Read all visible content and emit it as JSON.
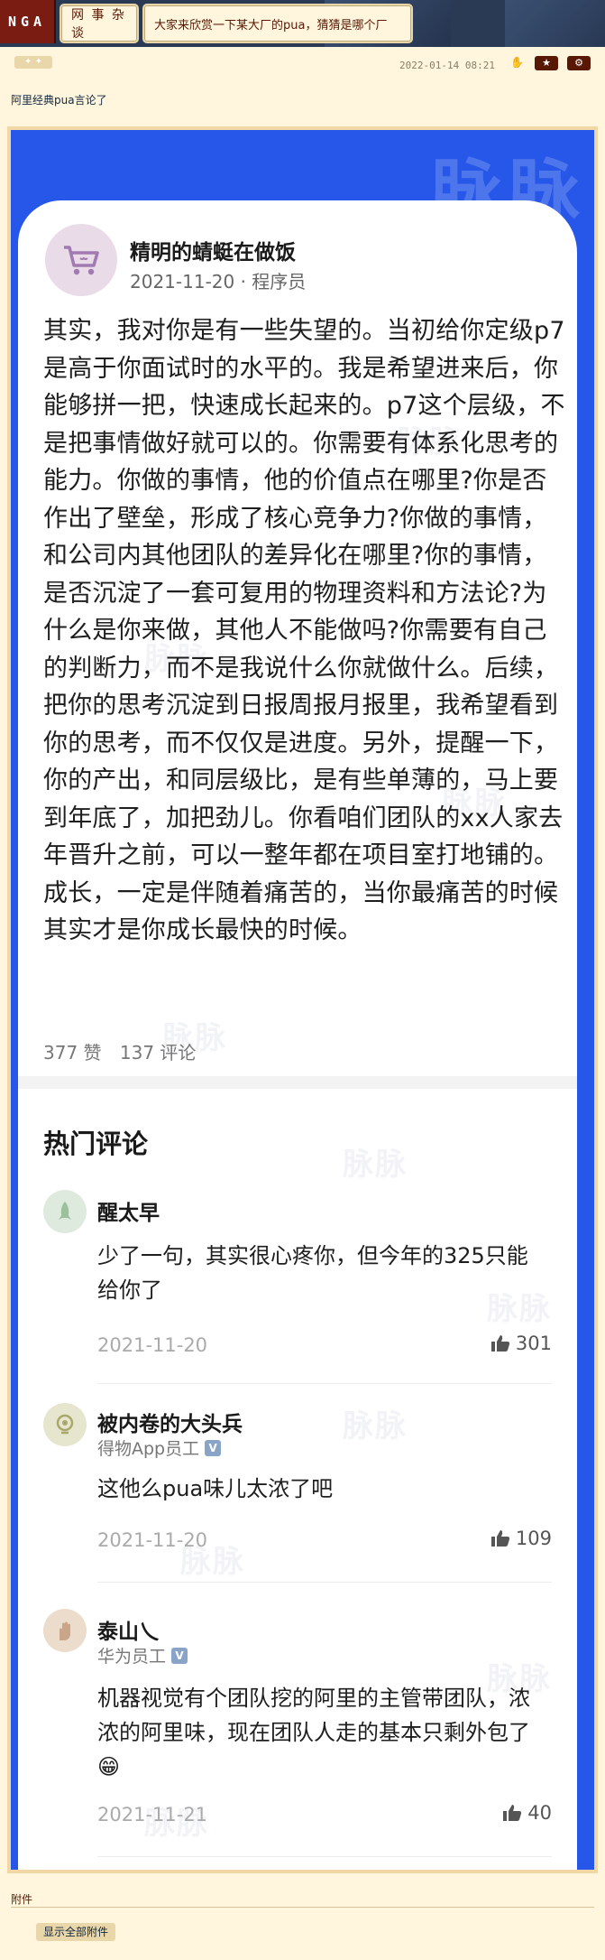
{
  "nav": {
    "logo": "NGA",
    "forum": "网 事 杂 谈",
    "thread_title": "大家来欣赏一下某大厂的pua，猜猜是哪个厂"
  },
  "post": {
    "time": "2022-01-14 08:21",
    "subject": "阿里经典pua言论了",
    "buttons": {
      "star": "★",
      "gear": "⚙"
    }
  },
  "image": {
    "watermark": "脉脉",
    "author": "精明的蜻蜓在做饭",
    "meta": "2021-11-20 · 程序员",
    "body": "其实，我对你是有一些失望的。当初给你定级p7是高于你面试时的水平的。我是希望进来后，你能够拼一把，快速成长起来的。p7这个层级，不是把事情做好就可以的。你需要有体系化思考的能力。你做的事情，他的价值点在哪里?你是否作出了壁垒，形成了核心竞争力?你做的事情，和公司内其他团队的差异化在哪里?你的事情，是否沉淀了一套可复用的物理资料和方法论?为什么是你来做，其他人不能做吗?你需要有自己的判断力，而不是我说什么你就做什么。后续，把你的思考沉淀到日报周报月报里，我希望看到你的思考，而不仅仅是进度。另外，提醒一下，你的产出，和同层级比，是有些单薄的，马上要到年底了，加把劲儿。你看咱们团队的xx人家去年晋升之前，可以一整年都在项目室打地铺的。成长，一定是伴随着痛苦的，当你最痛苦的时候其实才是你成长最快的时候。",
    "likes": "377 赞",
    "comments": "137 评论",
    "hot_title": "热门评论",
    "hot_comments": [
      {
        "name": "醒太早",
        "org": "",
        "text": "少了一句，其实很心疼你，但今年的325只能给你了",
        "date": "2021-11-20",
        "likes": "301"
      },
      {
        "name": "被内卷的大头兵",
        "org": "得物App员工",
        "text": "这他么pua味儿太浓了吧",
        "date": "2021-11-20",
        "likes": "109"
      },
      {
        "name": "泰山乀",
        "org": "华为员工",
        "text": "机器视觉有个团队挖的阿里的主管带团队，浓浓的阿里味，现在团队人走的基本只剩外包了😁",
        "date": "2021-11-21",
        "likes": "40"
      }
    ],
    "v_badge": "V"
  },
  "footer": {
    "attachments_label": "附件",
    "show_all": "显示全部附件"
  },
  "colors": {
    "page_bg": "#fff6dd",
    "nav_bg": "#2a3a55",
    "logo_bg": "#7a1c12",
    "image_bg": "#2757e8",
    "accent": "#591804"
  }
}
